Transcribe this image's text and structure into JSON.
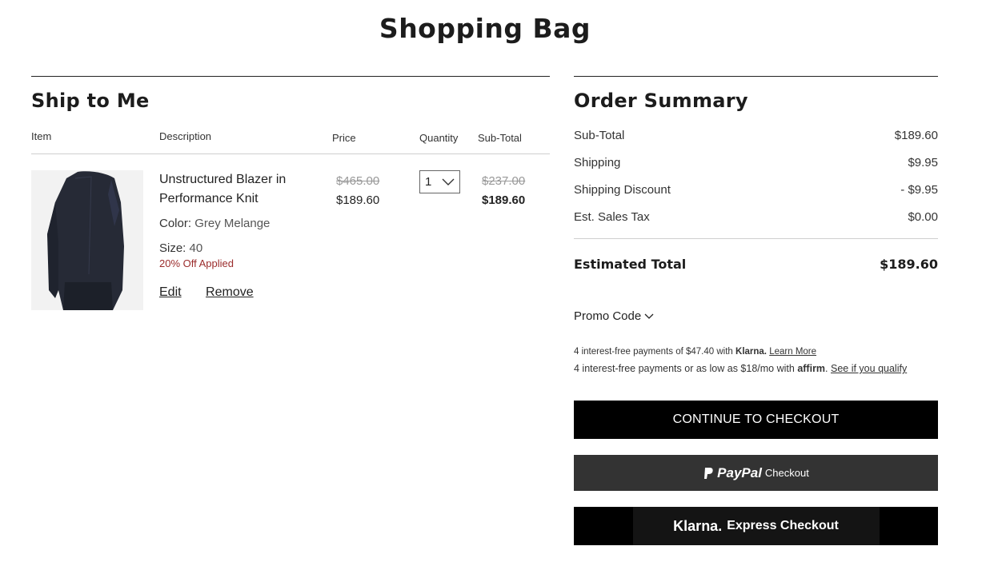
{
  "page": {
    "title": "Shopping Bag"
  },
  "bag": {
    "section_title": "Ship to Me",
    "columns": {
      "item": "Item",
      "description": "Description",
      "price": "Price",
      "quantity": "Quantity",
      "subtotal": "Sub-Total"
    },
    "items": [
      {
        "name": "Unstructured Blazer in Performance Knit",
        "color_label": "Color:",
        "color_value": "Grey Melange",
        "size_label": "Size:",
        "size_value": "40",
        "discount_note": "20% Off Applied",
        "original_price": "$465.00",
        "sale_price": "$189.60",
        "quantity": "1",
        "original_subtotal": "$237.00",
        "subtotal": "$189.60",
        "edit_label": "Edit",
        "remove_label": "Remove"
      }
    ]
  },
  "summary": {
    "title": "Order Summary",
    "rows": [
      {
        "label": "Sub-Total",
        "value": "$189.60"
      },
      {
        "label": "Shipping",
        "value": "$9.95"
      },
      {
        "label": "Shipping Discount",
        "value": "- $9.95"
      },
      {
        "label": "Est. Sales Tax",
        "value": "$0.00"
      }
    ],
    "total_label": "Estimated Total",
    "total_value": "$189.60",
    "promo_label": "Promo Code",
    "klarna_line_prefix": "4 interest-free payments of $47.40 with",
    "klarna_brand": "Klarna.",
    "klarna_link": "Learn More",
    "affirm_line_prefix": "4 interest-free payments or as low as $18/mo with",
    "affirm_brand": "affirm",
    "affirm_link": "See if you qualify",
    "checkout_label": "CONTINUE TO CHECKOUT",
    "paypal_brand": "PayPal",
    "paypal_text": "Checkout",
    "klarna_btn_brand": "Klarna.",
    "klarna_btn_text": "Express Checkout"
  },
  "colors": {
    "accent_black": "#000000",
    "discount_red": "#9b2c2c",
    "paypal_gray": "#333333"
  }
}
